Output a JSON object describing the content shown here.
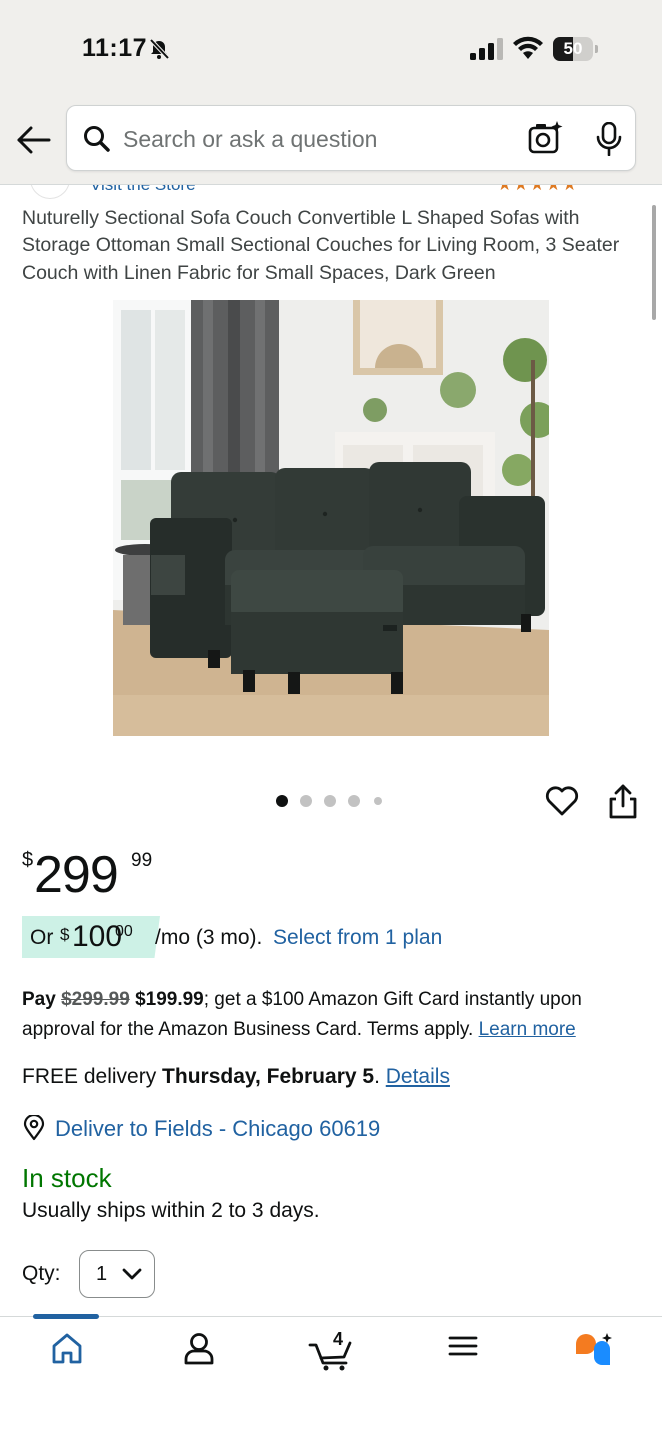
{
  "status_bar": {
    "time": "11:17",
    "battery": "50",
    "battery_level": 0.5
  },
  "search": {
    "placeholder": "Search or ask a question"
  },
  "store_peek": {
    "store_link": "Visit the Store",
    "rating_stars": "★★★★★"
  },
  "product": {
    "title": "Nuturelly Sectional Sofa Couch Convertible L Shaped Sofas with Storage Ottoman Small Sectional Couches for Living Room, 3 Seater Couch with Linen Fabric for Small Spaces, Dark Green",
    "image_count": 5,
    "active_image": 1
  },
  "price": {
    "symbol": "$",
    "whole": "299",
    "fraction": "99"
  },
  "monthly": {
    "or": "Or",
    "symbol": "$",
    "whole": "100",
    "fraction": "00",
    "term": "/mo (3 mo).",
    "plan_link": "Select from 1 plan"
  },
  "promo": {
    "pay": "Pay",
    "old_price": "$299.99",
    "new_price": "$199.99",
    "text": "; get a $100 Amazon Gift Card instantly upon approval for the Amazon Business Card. Terms apply.",
    "link": "Learn more"
  },
  "delivery": {
    "prefix": "FREE delivery",
    "date": "Thursday, February 5",
    "period": ".",
    "details_link": "Details",
    "deliver_to": "Deliver to Fields - Chicago 60619"
  },
  "stock": {
    "status": "In stock",
    "ships": "Usually ships within 2 to 3 days."
  },
  "quantity": {
    "label": "Qty:",
    "value": "1"
  },
  "bottom_nav": {
    "cart_count": "4",
    "active": "home"
  },
  "colors": {
    "link": "#2162a1",
    "in_stock": "#007600",
    "mint": "#cdf1e6",
    "header_bg": "#f0efec"
  }
}
